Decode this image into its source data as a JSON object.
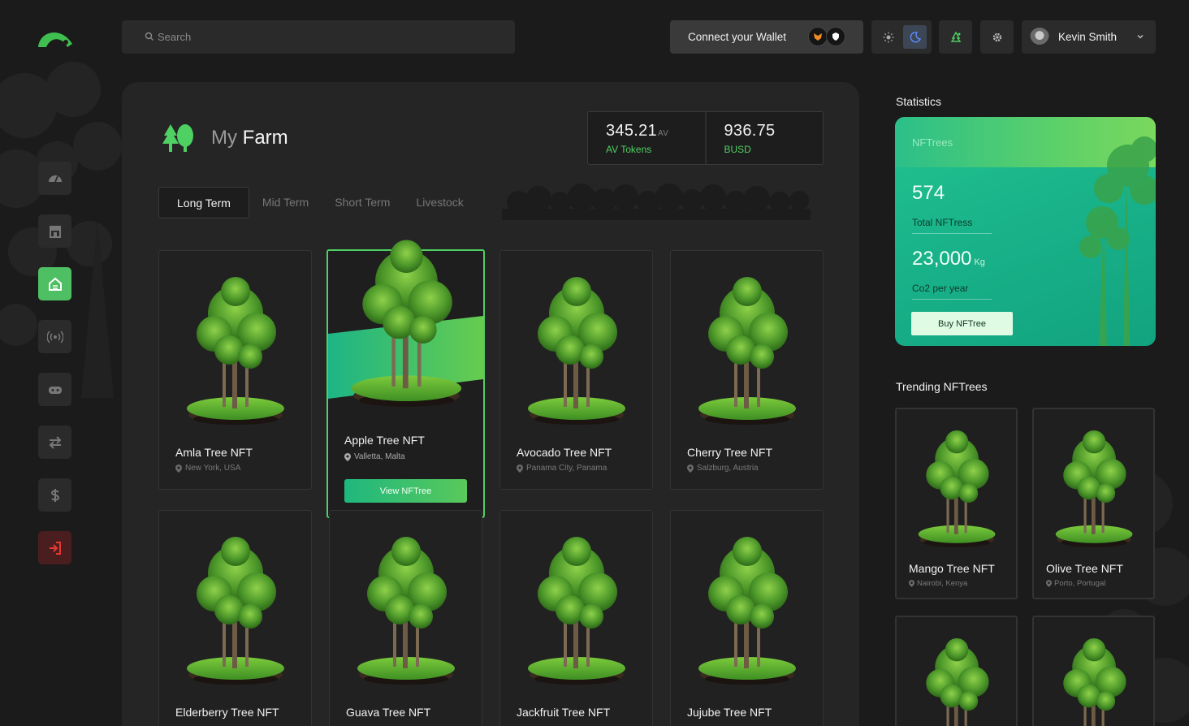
{
  "app": {
    "logo": "logo-icon"
  },
  "search": {
    "placeholder": "Search"
  },
  "header": {
    "wallet_label": "Connect your Wallet",
    "user_name": "Kevin Smith",
    "theme": "dark"
  },
  "sidebar": {
    "items": [
      {
        "name": "dashboard",
        "icon": "gauge-icon",
        "active": false
      },
      {
        "name": "marketplace",
        "icon": "store-icon",
        "active": false
      },
      {
        "name": "farm",
        "icon": "farm-icon",
        "active": true
      },
      {
        "name": "broadcast",
        "icon": "signal-icon",
        "active": false
      },
      {
        "name": "games",
        "icon": "gamepad-icon",
        "active": false
      },
      {
        "name": "exchange",
        "icon": "swap-icon",
        "active": false
      },
      {
        "name": "finance",
        "icon": "dollar-icon",
        "active": false
      },
      {
        "name": "logout",
        "icon": "logout-icon",
        "active": false
      }
    ]
  },
  "farm": {
    "title_light": "My",
    "title_bold": "Farm",
    "stats": [
      {
        "value": "345.21",
        "unit": "AV",
        "label": "AV Tokens"
      },
      {
        "value": "936.75",
        "unit": "",
        "label": "BUSD"
      }
    ],
    "tabs": [
      "Long Term",
      "Mid Term",
      "Short Term",
      "Livestock"
    ],
    "active_tab": "Long Term",
    "cards": [
      {
        "name": "Amla Tree NFT",
        "location": "New York, USA"
      },
      {
        "name": "Apple Tree NFT",
        "location": "Valletta, Malta",
        "featured": true,
        "button": "View NFTree"
      },
      {
        "name": "Avocado Tree NFT",
        "location": "Panama City, Panama"
      },
      {
        "name": "Cherry Tree NFT",
        "location": "Salzburg, Austria"
      },
      {
        "name": "Elderberry Tree NFT",
        "location": ""
      },
      {
        "name": "Guava Tree NFT",
        "location": ""
      },
      {
        "name": "Jackfruit Tree NFT",
        "location": ""
      },
      {
        "name": "Jujube Tree NFT",
        "location": ""
      }
    ]
  },
  "statistics": {
    "title": "Statistics",
    "panel_label": "NFTrees",
    "total_value": "574",
    "total_label": "Total NFTress",
    "co2_value": "23,000",
    "co2_unit": "Kg",
    "co2_label": "Co2 per year",
    "buy_label": "Buy NFTree"
  },
  "trending": {
    "title": "Trending NFTrees",
    "items": [
      {
        "name": "Mango Tree NFT",
        "location": "Nairobi, Kenya"
      },
      {
        "name": "Olive Tree NFT",
        "location": "Porto, Portugal"
      },
      {
        "name": "",
        "location": ""
      },
      {
        "name": "",
        "location": ""
      }
    ]
  },
  "colors": {
    "accent": "#4fd063",
    "panel": "#252525",
    "bg": "#1b1b1b",
    "logout": "#e53935"
  }
}
